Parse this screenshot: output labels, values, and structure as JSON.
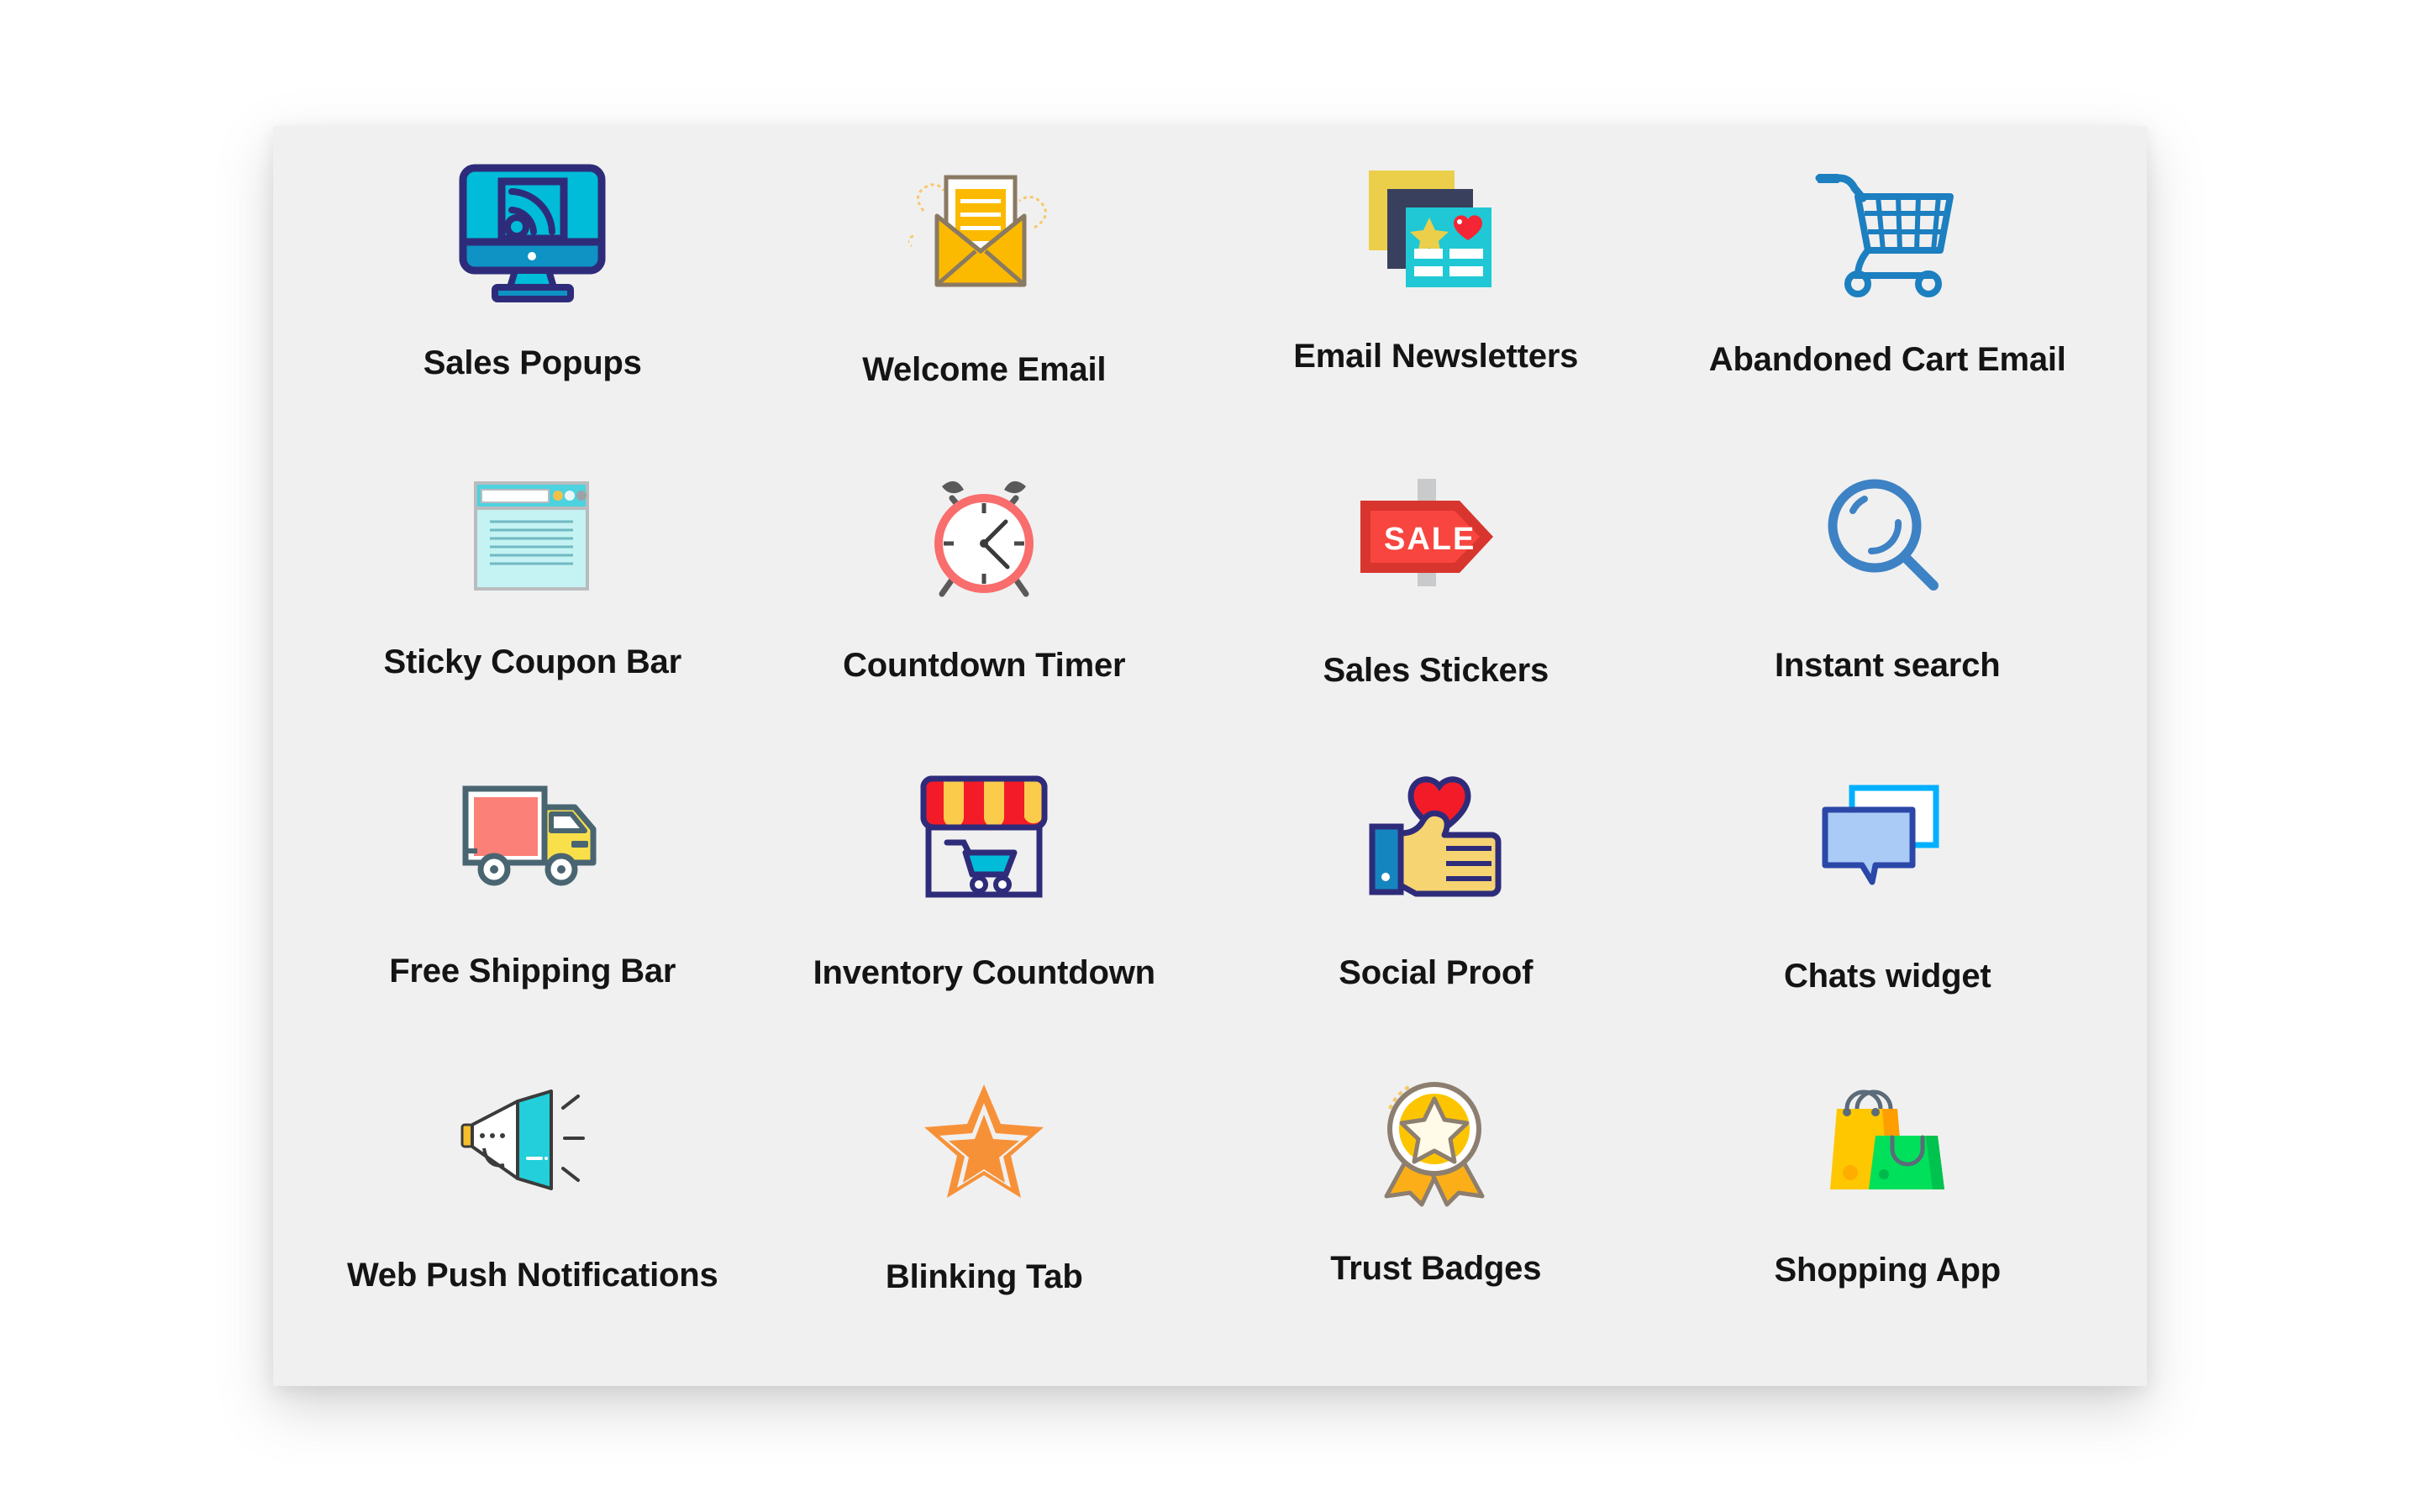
{
  "panel": {
    "background_color": "#f0f0f0",
    "page_background_color": "#ffffff"
  },
  "grid": {
    "columns": 4,
    "rows": 4,
    "items": [
      {
        "label": "Sales Popups",
        "icon": "monitor-rss-icon",
        "colors": [
          "#00BCD8",
          "#2E2C7A",
          "#0E93C4"
        ]
      },
      {
        "label": "Welcome Email",
        "icon": "open-envelope-icon",
        "colors": [
          "#FBBA00",
          "#8A7A63",
          "#FFFFFF"
        ]
      },
      {
        "label": "Email Newsletters",
        "icon": "stacked-cards-icon",
        "colors": [
          "#EBCF4B",
          "#39405E",
          "#1FC8D4",
          "#F42534"
        ]
      },
      {
        "label": "Abandoned Cart Email",
        "icon": "shopping-cart-icon",
        "colors": [
          "#1C7FC0"
        ]
      },
      {
        "label": "Sticky Coupon Bar",
        "icon": "browser-window-icon",
        "colors": [
          "#4DD2DF",
          "#C5F2F2",
          "#B9BCBE",
          "#F2C14B"
        ]
      },
      {
        "label": "Countdown Timer",
        "icon": "alarm-clock-icon",
        "colors": [
          "#F96D6D",
          "#FFFFFF",
          "#5A5A5A"
        ]
      },
      {
        "label": "Sales Stickers",
        "icon": "sale-sign-icon",
        "colors": [
          "#F9453F",
          "#D8352F",
          "#C9CACB",
          "#FFFFFF"
        ],
        "sign_text": "SALE"
      },
      {
        "label": "Instant search",
        "icon": "magnifier-icon",
        "colors": [
          "#3D82C4"
        ]
      },
      {
        "label": "Free Shipping Bar",
        "icon": "delivery-truck-icon",
        "colors": [
          "#FA8078",
          "#F9E04B",
          "#4A6572",
          "#FFFFFF"
        ]
      },
      {
        "label": "Inventory Countdown",
        "icon": "shop-awning-cart-icon",
        "colors": [
          "#F41B28",
          "#FBCB4C",
          "#2E2C7A",
          "#00BCD8"
        ]
      },
      {
        "label": "Social Proof",
        "icon": "thumbs-up-heart-icon",
        "colors": [
          "#F6D472",
          "#F41B28",
          "#1585C0",
          "#2E2C7A"
        ]
      },
      {
        "label": "Chats widget",
        "icon": "chat-bubbles-icon",
        "colors": [
          "#00B0FF",
          "#A9CBF5",
          "#2B47A8",
          "#FFFFFF"
        ]
      },
      {
        "label": "Web Push Notifications",
        "icon": "megaphone-icon",
        "colors": [
          "#22CFDA",
          "#FFFFFF",
          "#F6BE2C",
          "#3B3B3B"
        ]
      },
      {
        "label": "Blinking Tab",
        "icon": "star-outline-icon",
        "colors": [
          "#F79138",
          "#F0F0F0"
        ]
      },
      {
        "label": "Trust Badges",
        "icon": "award-medal-icon",
        "colors": [
          "#FCC500",
          "#FBAE17",
          "#8D7F6F",
          "#FFFBE8"
        ]
      },
      {
        "label": "Shopping App",
        "icon": "shopping-bags-icon",
        "colors": [
          "#FFC700",
          "#FF9E00",
          "#00E05A",
          "#00C24E",
          "#5B6B79"
        ]
      }
    ]
  }
}
